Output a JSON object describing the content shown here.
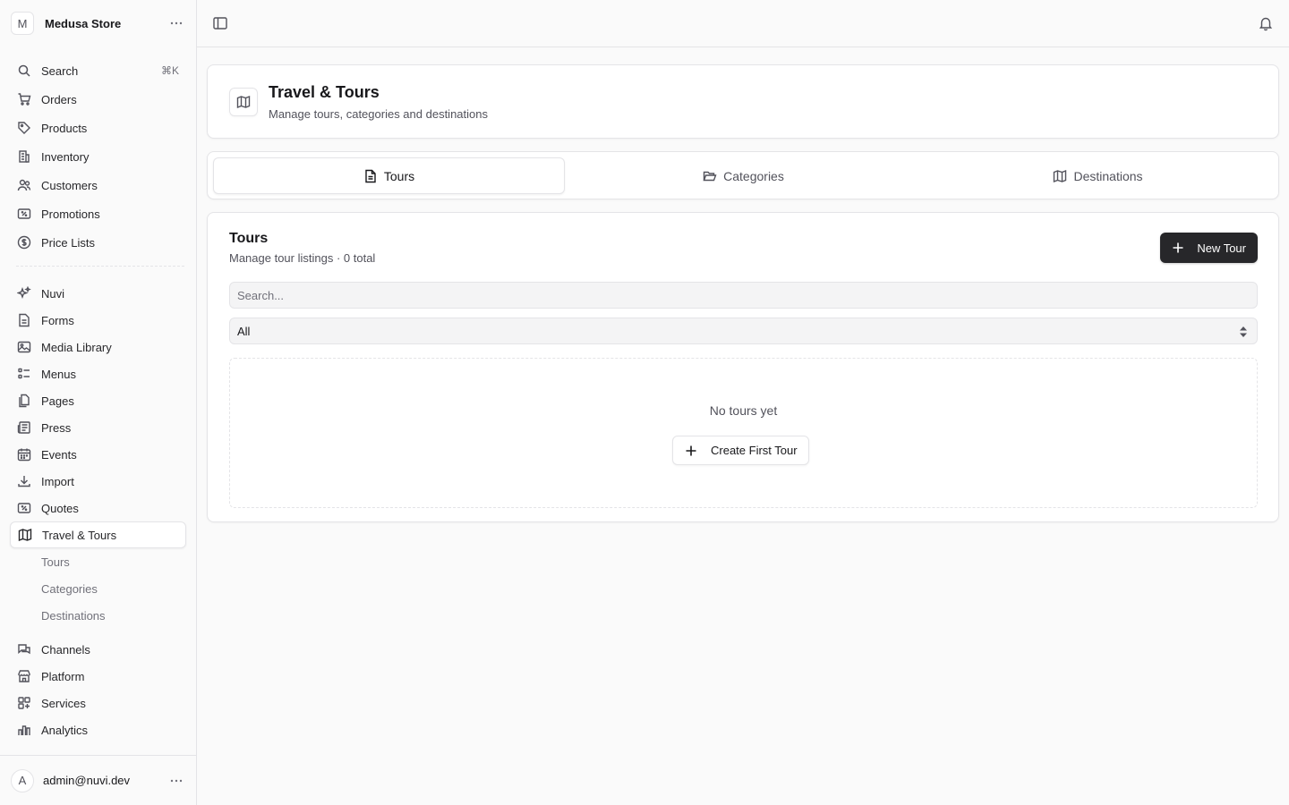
{
  "store": {
    "initial": "M",
    "name": "Medusa Store"
  },
  "search": {
    "label": "Search",
    "shortcut": "⌘K"
  },
  "nav_primary": [
    {
      "label": "Orders",
      "icon": "cart-icon"
    },
    {
      "label": "Products",
      "icon": "tag-icon"
    },
    {
      "label": "Inventory",
      "icon": "building-icon"
    },
    {
      "label": "Customers",
      "icon": "users-icon"
    },
    {
      "label": "Promotions",
      "icon": "receipt-percent-icon"
    },
    {
      "label": "Price Lists",
      "icon": "currency-dollar-icon"
    }
  ],
  "nav_extensions": [
    {
      "label": "Nuvi",
      "icon": "sparkles-icon"
    },
    {
      "label": "Forms",
      "icon": "document-text-icon"
    },
    {
      "label": "Media Library",
      "icon": "photo-icon"
    },
    {
      "label": "Menus",
      "icon": "list-bullet-icon"
    },
    {
      "label": "Pages",
      "icon": "document-duplicate-icon"
    },
    {
      "label": "Press",
      "icon": "newspaper-icon"
    },
    {
      "label": "Events",
      "icon": "calendar-icon"
    },
    {
      "label": "Import",
      "icon": "arrow-down-tray-icon"
    },
    {
      "label": "Quotes",
      "icon": "receipt-percent-icon"
    },
    {
      "label": "Travel & Tours",
      "icon": "map-icon",
      "active": true
    }
  ],
  "nav_sub": [
    "Tours",
    "Categories",
    "Destinations"
  ],
  "nav_more": [
    {
      "label": "Channels",
      "icon": "chat-bubbles-icon"
    },
    {
      "label": "Platform",
      "icon": "buildings-icon"
    },
    {
      "label": "Services",
      "icon": "squares-plus-icon"
    },
    {
      "label": "Analytics",
      "icon": "chart-bar-icon"
    }
  ],
  "user": {
    "initial": "A",
    "email": "admin@nuvi.dev"
  },
  "header": {
    "title": "Travel & Tours",
    "subtitle": "Manage tours, categories and destinations"
  },
  "tabs": [
    {
      "label": "Tours",
      "icon": "document-icon",
      "active": true
    },
    {
      "label": "Categories",
      "icon": "folder-open-icon"
    },
    {
      "label": "Destinations",
      "icon": "map-icon"
    }
  ],
  "section": {
    "title": "Tours",
    "subtitle": "Manage tour listings · 0 total",
    "new_button": "New Tour",
    "search_placeholder": "Search...",
    "filter_value": "All",
    "empty_text": "No tours yet",
    "create_button": "Create First Tour"
  }
}
